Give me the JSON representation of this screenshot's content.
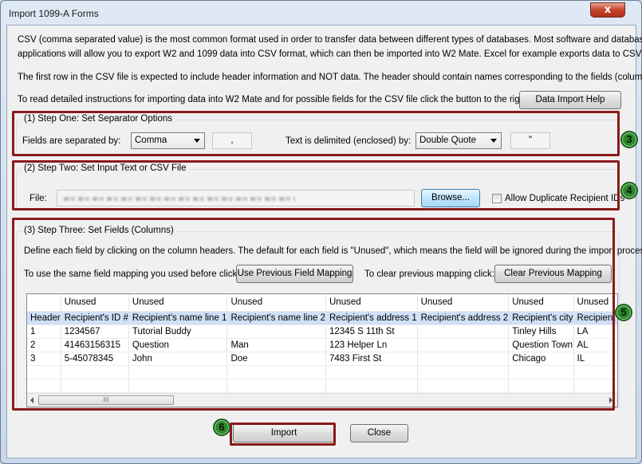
{
  "window": {
    "title": "Import 1099-A Forms",
    "close_glyph": "x"
  },
  "intro": {
    "line1": "CSV (comma separated value) is the most common format used in order to transfer data between different types of databases.  Most software and database",
    "line2": "applications will allow you to export W2 and 1099 data into CSV format, which can then be imported into W2 Mate. Excel for example exports data to CSV .",
    "line3": "The first row in the CSV file is expected to include header information and NOT data. The header should contain names corresponding to the fields (columns) .",
    "line4": "To read detailed instructions for importing data into W2 Mate and for possible fields for the CSV file click the button to the right :",
    "help_button": "Data Import Help"
  },
  "step1": {
    "title": "(1)  Step One: Set Separator Options",
    "sep_label": "Fields are separated by:",
    "sep_value": "Comma",
    "sep_char": ",",
    "delim_label": "Text is delimited (enclosed) by:",
    "delim_value": "Double Quote",
    "delim_char": "\"",
    "badge": "3"
  },
  "step2": {
    "title": "(2)  Step Two: Set Input Text or CSV File",
    "file_label": "File:",
    "browse_button": "Browse...",
    "allow_dup_label": "Allow Duplicate Recipient IDs",
    "allow_dup_checked": false,
    "badge": "4"
  },
  "step3": {
    "title": "(3)  Step Three: Set Fields (Columns)",
    "desc": "Define each field by clicking on the column headers. The default for each field is \"Unused\", which means the field will be ignored during the import process.",
    "reuse_label": "To use the same field mapping you used before click:",
    "reuse_button": "Use Previous Field Mapping",
    "clear_label": "To clear previous mapping click:",
    "clear_button": "Clear Previous Mapping",
    "badge": "5",
    "scroll_thumb": "III",
    "grid": {
      "column_mappings": [
        "",
        "Unused",
        "Unused",
        "Unused",
        "Unused",
        "Unused",
        "Unused",
        "Unused"
      ],
      "header_row": [
        "Header",
        "Recipient's ID #",
        "Recipient's name line 1",
        "Recipient's name line 2",
        "Recipient's address 1",
        "Recipient's address 2",
        "Recipient's city",
        "Recipient's state"
      ],
      "rows": [
        [
          "1",
          "1234567",
          "Tutorial Buddy",
          "",
          "12345 S 11th St",
          "",
          "Tinley Hills",
          "LA"
        ],
        [
          "2",
          "41463156315",
          "Question",
          "Man",
          "123 Helper Ln",
          "",
          "Question Town",
          "AL"
        ],
        [
          "3",
          "5-45078345",
          "John",
          "Doe",
          "7483 First St",
          "",
          "Chicago",
          "IL"
        ]
      ]
    }
  },
  "footer": {
    "import_button": "Import",
    "close_button": "Close",
    "badge": "6"
  },
  "colors": {
    "annotation_red": "#8b1a1a",
    "badge_green": "#2a8a2a",
    "selected_row": "#cfe0f7"
  }
}
